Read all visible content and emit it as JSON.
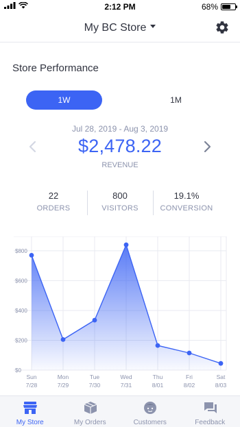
{
  "status_bar": {
    "time": "2:12 PM",
    "battery": "68%",
    "battery_level": 0.68
  },
  "header": {
    "title": "My BC Store"
  },
  "store_performance": {
    "title": "Store Performance",
    "tabs": [
      "1W",
      "1M"
    ],
    "selected_tab": "1W",
    "date_range": "Jul 28, 2019 - Aug 3, 2019",
    "revenue": "$2,478.22",
    "revenue_label": "REVENUE"
  },
  "stats": [
    {
      "value": "22",
      "label": "ORDERS"
    },
    {
      "value": "800",
      "label": "VISITORS"
    },
    {
      "value": "19.1%",
      "label": "CONVERSION"
    }
  ],
  "chart_data": {
    "type": "area",
    "x": [
      "Sun 7/28",
      "Mon 7/29",
      "Tue 7/30",
      "Wed 7/31",
      "Thu 8/01",
      "Fri 8/02",
      "Sat 8/03"
    ],
    "x_day": [
      "Sun",
      "Mon",
      "Tue",
      "Wed",
      "Thu",
      "Fri",
      "Sat"
    ],
    "x_date": [
      "7/28",
      "7/29",
      "7/30",
      "7/31",
      "8/01",
      "8/02",
      "8/03"
    ],
    "values": [
      770,
      205,
      335,
      840,
      165,
      115,
      45
    ],
    "y_ticks": [
      "$0",
      "$200",
      "$400",
      "$600",
      "$800"
    ],
    "y_tick_values": [
      0,
      200,
      400,
      600,
      800
    ],
    "ylim": [
      0,
      850
    ],
    "grid": true,
    "color": "#3c64f4"
  },
  "tab_bar": [
    {
      "label": "My Store",
      "icon": "store-icon",
      "active": true
    },
    {
      "label": "My Orders",
      "icon": "box-icon",
      "active": false
    },
    {
      "label": "Customers",
      "icon": "face-icon",
      "active": false
    },
    {
      "label": "Feedback",
      "icon": "chat-icon",
      "active": false
    }
  ],
  "colors": {
    "accent": "#3c64f4",
    "muted": "#8c93ad",
    "text": "#313440"
  }
}
